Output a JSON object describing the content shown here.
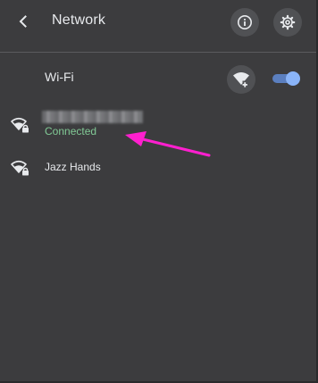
{
  "header": {
    "title": "Network",
    "back_icon": "chevron-left-icon",
    "info_icon": "info-icon",
    "settings_icon": "gear-icon"
  },
  "wifi": {
    "label": "Wi-Fi",
    "add_network_icon": "wifi-add-icon",
    "enabled": true
  },
  "networks": [
    {
      "name": "",
      "status": "Connected",
      "icon": "wifi-lock-icon"
    },
    {
      "name": "Jazz Hands",
      "status": "",
      "icon": "wifi-lock-icon"
    }
  ],
  "colors": {
    "background": "#3c3c3e",
    "text": "#e8eaed",
    "connected": "#81c995",
    "toggle_knob": "#8ab4f8",
    "toggle_track": "#5b7fbf",
    "annotation_arrow": "#ff1fcf"
  }
}
